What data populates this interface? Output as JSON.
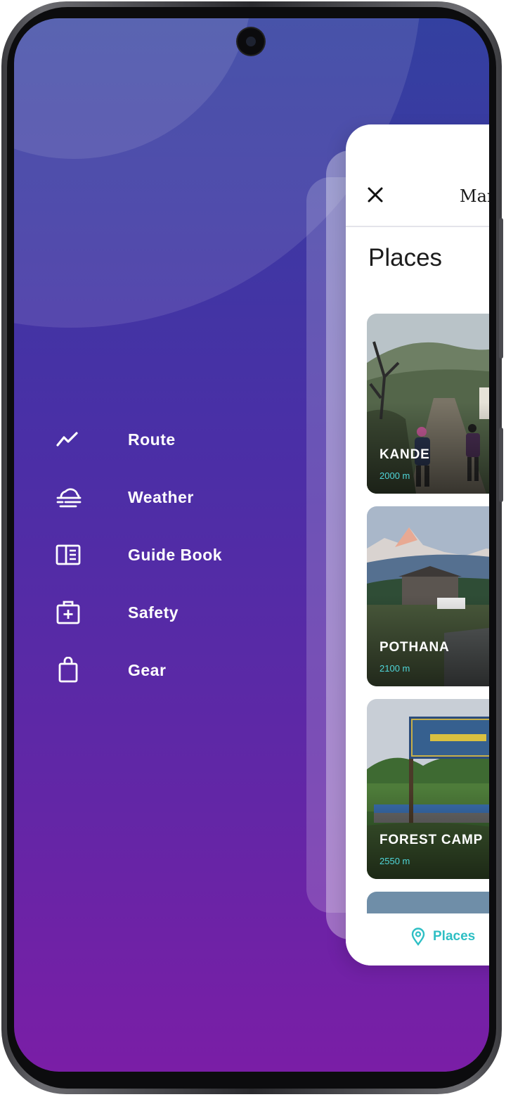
{
  "menu": {
    "items": [
      {
        "label": "Route",
        "icon": "route-icon"
      },
      {
        "label": "Weather",
        "icon": "weather-icon"
      },
      {
        "label": "Guide Book",
        "icon": "guide-book-icon"
      },
      {
        "label": "Safety",
        "icon": "first-aid-icon"
      },
      {
        "label": "Gear",
        "icon": "bag-icon"
      }
    ]
  },
  "panel": {
    "header_title": "Mar",
    "section_title": "Places",
    "places": [
      {
        "name": "KANDE",
        "altitude": "2000 m"
      },
      {
        "name": "POTHANA",
        "altitude": "2100 m"
      },
      {
        "name": "FOREST CAMP",
        "altitude": "2550 m"
      }
    ],
    "bottom_nav": {
      "places_label": "Places"
    }
  },
  "colors": {
    "gradient_top": "#3340a0",
    "gradient_bottom": "#7a1ea6",
    "accent": "#2ebfc4",
    "altitude": "#4fd6d9"
  }
}
